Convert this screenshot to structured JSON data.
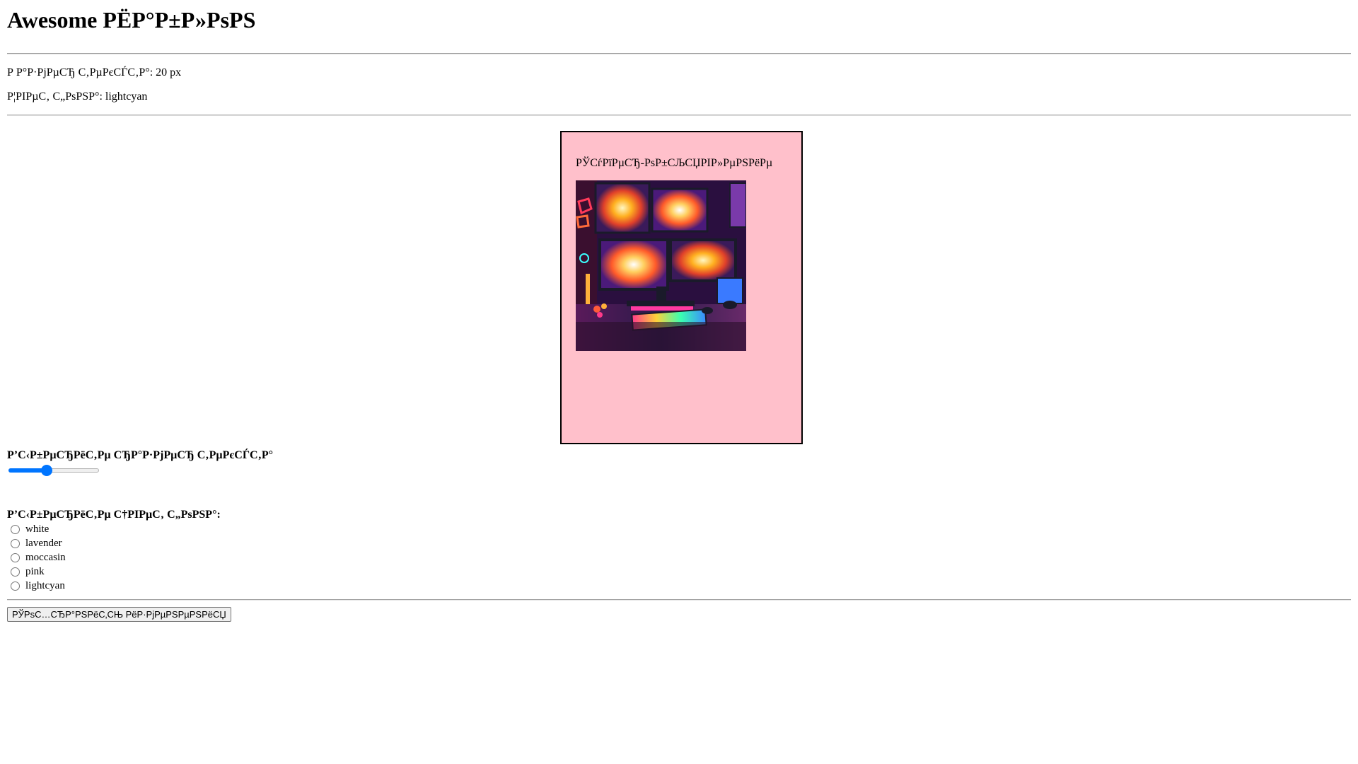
{
  "header": {
    "title": "Awesome РЁР°Р±Р»РѕРЅ"
  },
  "info": {
    "font_size_line": "Р Р°Р·РјРµСЂ С‚РµРєСЃС‚Р°: 20 px",
    "bg_color_line": "Р¦РІРµС‚ С„РѕРЅР°: lightcyan"
  },
  "preview": {
    "text": "РЎСѓРїРµСЂ-РѕР±СЉСЏРІР»РµРЅРёРµ",
    "background_color": "#ffc0cb",
    "image_icon": "gaming-setup-image"
  },
  "size_control": {
    "label": "Р’С‹Р±РµСЂРёС‚Рµ СЂР°Р·РјРµСЂ С‚РµРєСЃС‚Р°",
    "value_fraction": 0.41,
    "accent_color": "#0075ff"
  },
  "color_control": {
    "label": "Р’С‹Р±РµСЂРёС‚Рµ С†РІРµС‚ С„РѕРЅР°:",
    "options": [
      {
        "label": "white"
      },
      {
        "label": "lavender"
      },
      {
        "label": "moccasin"
      },
      {
        "label": "pink"
      },
      {
        "label": "lightcyan"
      }
    ]
  },
  "actions": {
    "save_label": "РЎРѕС…СЂР°РЅРёС‚СЊ РёР·РјРµРЅРµРЅРёСЏ"
  }
}
